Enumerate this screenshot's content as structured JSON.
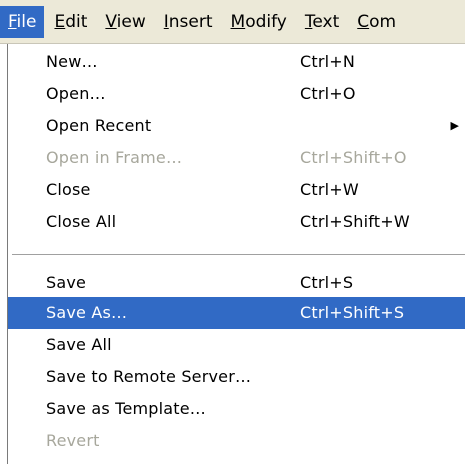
{
  "menubar": {
    "items": [
      {
        "mnemonic": "F",
        "rest": "ile"
      },
      {
        "mnemonic": "E",
        "rest": "dit"
      },
      {
        "mnemonic": "V",
        "rest": "iew"
      },
      {
        "mnemonic": "I",
        "rest": "nsert"
      },
      {
        "mnemonic": "M",
        "rest": "odify"
      },
      {
        "mnemonic": "T",
        "rest": "ext"
      },
      {
        "mnemonic": "C",
        "rest": "om"
      }
    ]
  },
  "file_menu": {
    "items": [
      {
        "label": "New…",
        "shortcut": "Ctrl+N"
      },
      {
        "label": "Open…",
        "shortcut": "Ctrl+O"
      },
      {
        "label": "Open Recent",
        "shortcut": ""
      },
      {
        "label": "Open in Frame…",
        "shortcut": "Ctrl+Shift+O"
      },
      {
        "label": "Close",
        "shortcut": "Ctrl+W"
      },
      {
        "label": "Close All",
        "shortcut": "Ctrl+Shift+W"
      },
      {
        "label": "Save",
        "shortcut": "Ctrl+S"
      },
      {
        "label": "Save As…",
        "shortcut": "Ctrl+Shift+S"
      },
      {
        "label": "Save All",
        "shortcut": ""
      },
      {
        "label": "Save to Remote Server…",
        "shortcut": ""
      },
      {
        "label": "Save as Template…",
        "shortcut": ""
      },
      {
        "label": "Revert",
        "shortcut": ""
      }
    ]
  },
  "colors": {
    "menubar_bg": "#ece9d8",
    "highlight": "#316ac5",
    "disabled_text": "#a7a79c"
  }
}
